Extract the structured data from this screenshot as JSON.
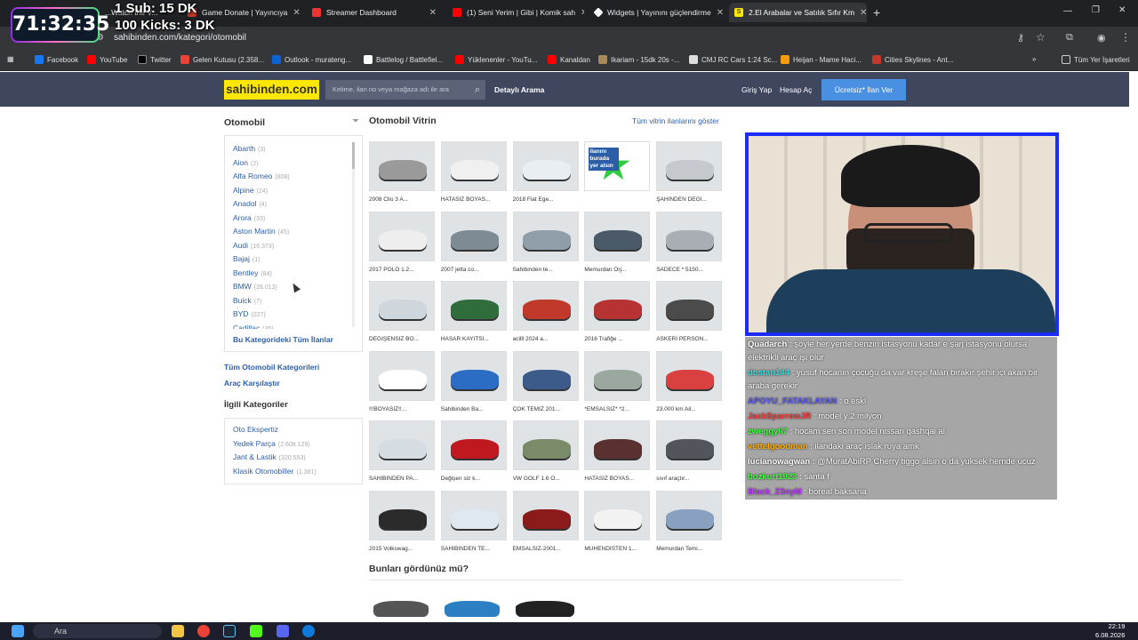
{
  "overlay": {
    "timer": "71:32:35",
    "sub_line": "1 Sub: 15 DK",
    "kick_line": "100 Kicks: 3 DK"
  },
  "browser": {
    "tabs": [
      {
        "label": "...Watch the V..."
      },
      {
        "label": "Game Donate | Yayıncıya"
      },
      {
        "label": "Streamer Dashboard"
      },
      {
        "label": "(1) Seni Yerim | Gibi | Komik sah"
      },
      {
        "label": "Widgets | Yayınını güçlendirme"
      },
      {
        "label": "2.El Arabalar ve Satılık Sıfır Km"
      }
    ],
    "url": "sahibinden.com/kategori/otomobil",
    "bookmarks": [
      "Facebook",
      "YouTube",
      "Twitter",
      "Gelen Kutusu (2.358...",
      "Outlook - murateng...",
      "Battlelog / Battlefiel...",
      "Yüklenenler - YouTu...",
      "Kanaldan",
      "Ikariam - 15dk 20s -...",
      "CMJ RC Cars 1:24 Sc...",
      "Heijan - Mame Haci...",
      "Cities Skylines - Ant...",
      "Tüm Yer İşaretleri"
    ]
  },
  "site": {
    "logo": "sahibinden.com",
    "search_placeholder": "Kelime, ilan no veya mağaza adı ile ara",
    "detailed_search": "Detaylı Arama",
    "login": "Giriş Yap",
    "register": "Hesap Aç",
    "post_ad": "Ücretsiz* İlan Ver"
  },
  "sidebar": {
    "title": "Otomobil",
    "brands": [
      {
        "name": "Abarth",
        "count": "(3)"
      },
      {
        "name": "Aion",
        "count": "(2)"
      },
      {
        "name": "Alfa Romeo",
        "count": "(808)"
      },
      {
        "name": "Alpine",
        "count": "(24)"
      },
      {
        "name": "Anadol",
        "count": "(4)"
      },
      {
        "name": "Arora",
        "count": "(33)"
      },
      {
        "name": "Aston Martin",
        "count": "(45)"
      },
      {
        "name": "Audi",
        "count": "(16.373)"
      },
      {
        "name": "Bajaj",
        "count": "(1)"
      },
      {
        "name": "Bentley",
        "count": "(84)"
      },
      {
        "name": "BMW",
        "count": "(28.013)"
      },
      {
        "name": "Buick",
        "count": "(7)"
      },
      {
        "name": "BYD",
        "count": "(227)"
      },
      {
        "name": "Cadillac",
        "count": "(35)"
      }
    ],
    "all_in_category": "Bu Kategorideki Tüm İlanlar",
    "all_categories": "Tüm Otomobil Kategorileri",
    "compare": "Araç Karşılaştır",
    "related_title": "İlgili Kategoriler",
    "related": [
      {
        "name": "Oto Ekspertiz",
        "count": ""
      },
      {
        "name": "Yedek Parça",
        "count": "(2.608.129)"
      },
      {
        "name": "Jant & Lastik",
        "count": "(320.553)"
      },
      {
        "name": "Klasik Otomobiller",
        "count": "(1.381)"
      }
    ]
  },
  "vitrin": {
    "title": "Otomobil Vitrin",
    "show_all": "Tüm vitrin ilanlarını göster",
    "ad_placeholder": "ilanını burada yer alsın",
    "items": [
      "2008 Clio 3 A...",
      "HATASIZ BOYAS...",
      "2018 Fiat Ege...",
      "",
      "ŞAHİNDEN DEĞİ...",
      "2017 POLO 1.2...",
      "2007 jetta co...",
      "Sahibinden te...",
      "Memurdan Orj...",
      "SADECE * 5150...",
      "DEĞİŞENSİZ BO...",
      "HASAR KAYITSI...",
      "acilll 2024 a...",
      "2016 Trafiğe ...",
      "ASKERİ PERSON...",
      "!!!BOYASIZ!!...",
      "Sahibinden Ba...",
      "ÇOK TEMİZ 201...",
      "*EMSALSİZ* *2...",
      "23.000 km Ail...",
      "SAHİBİNDEN PA...",
      "Değişen siz k...",
      "VW GOLF 1.6 O...",
      "HATASIZ BOYAS...",
      "sıvıf araçtır...",
      "2015 Volkswag...",
      "SAHİBİNDEN TE...",
      "EMSALSİZ-2001...",
      "MÜHENDİSTEN 1...",
      "Memurdan Temi..."
    ],
    "seen_title": "Bunları gördünüz mü?"
  },
  "chat": [
    {
      "user": "Quadarch",
      "color": "#ffffff",
      "msg": "şöyle her yerde benzin istasyonu kadar e şarj istasyonu olursa elektrikli araç işi olur"
    },
    {
      "user": "dostan144",
      "color": "#36e0e0",
      "msg": "yusuf hocanın çocuğu da var kreşe falan bırakır şehir içi akan bir araba gerekir"
    },
    {
      "user": "APOYU_FATAKLAYAN",
      "color": "#5a5aff",
      "msg": "o eski"
    },
    {
      "user": "JackSparrowJR",
      "color": "#ff4040",
      "msg": "model y 2 milyon"
    },
    {
      "user": "zweggy67",
      "color": "#3cff3c",
      "msg": "hocam sen son model nissan qashqai al"
    },
    {
      "user": "vettelgoodman",
      "color": "#ffb000",
      "msg": "ilandaki araç ıslak ruya amk"
    },
    {
      "user": "lucianowagwan",
      "color": "#ffffff",
      "msg": "@MuratAbiRP Cherry tiggo alsın o da yuksek hemde ucuz"
    },
    {
      "user": "bozkurt1923",
      "color": "#3cff3c",
      "msg": "santa f"
    },
    {
      "user": "Black_Z3nyM",
      "color": "#c040ff",
      "msg": "boreal baksana"
    }
  ],
  "taskbar": {
    "search": "Ara",
    "time": "22:19",
    "date": "6.08.2026"
  }
}
